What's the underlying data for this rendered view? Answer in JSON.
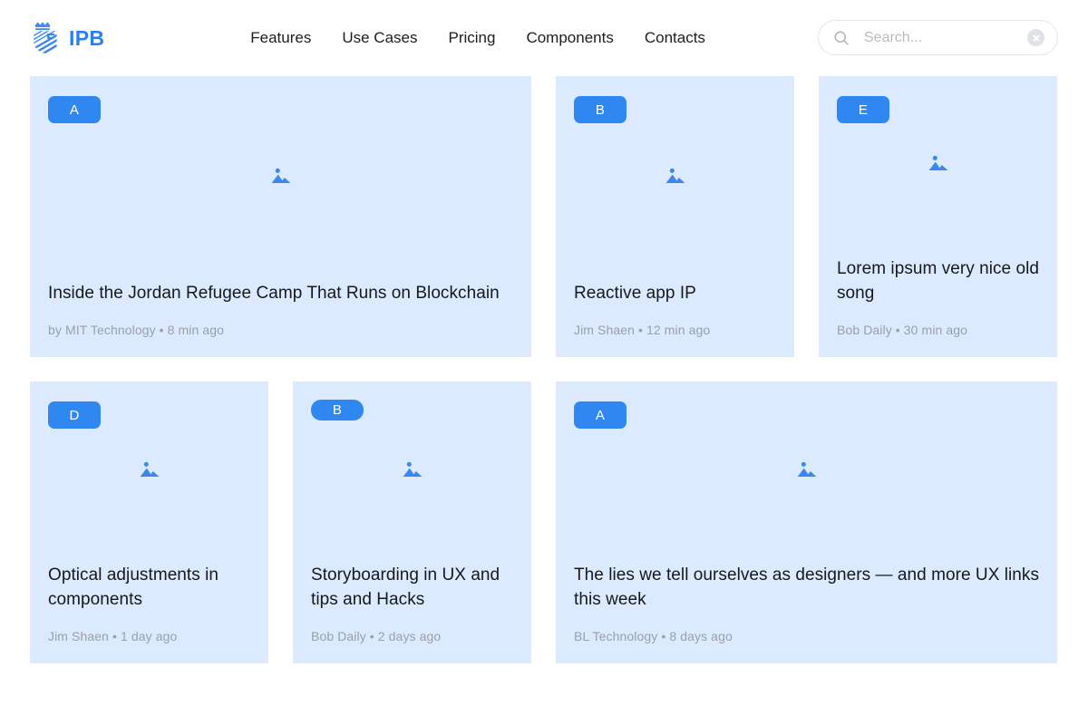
{
  "brand": {
    "name": "IPB",
    "logo_icon": "ipb-crest-icon",
    "color": "#2d7ff0"
  },
  "nav": {
    "items": [
      {
        "label": "Features"
      },
      {
        "label": "Use Cases"
      },
      {
        "label": "Pricing"
      },
      {
        "label": "Components"
      },
      {
        "label": "Contacts"
      }
    ]
  },
  "search": {
    "placeholder": "Search...",
    "value": "",
    "search_icon": "search-icon",
    "clear_icon": "clear-circle-icon"
  },
  "theme": {
    "card_bg": "#dbeafe",
    "badge_bg": "#2f88f0",
    "accent": "#2d7ff0",
    "title_color": "#16181c",
    "meta_color": "#9aa0a6",
    "page_bg": "#ffffff"
  },
  "rows": [
    {
      "cards": [
        {
          "badge": "A",
          "badge_shape": "rounded",
          "size": "wide",
          "title": "Inside the Jordan Refugee Camp That Runs on Blockchain",
          "meta": "by MIT Technology • 8 min ago",
          "author": "by MIT Technology",
          "time": "8 min ago",
          "thumb_icon": "image-placeholder-icon"
        },
        {
          "badge": "B",
          "badge_shape": "rounded",
          "size": "narrow",
          "title": "Reactive app IP",
          "meta": "Jim Shaen • 12 min ago",
          "author": "Jim Shaen",
          "time": "12 min ago",
          "thumb_icon": "image-placeholder-icon"
        },
        {
          "badge": "E",
          "badge_shape": "rounded",
          "size": "narrow",
          "title": "Lorem ipsum very nice old song",
          "meta": "Bob Daily • 30 min ago",
          "author": "Bob Daily",
          "time": "30 min ago",
          "thumb_icon": "image-placeholder-icon"
        }
      ]
    },
    {
      "cards": [
        {
          "badge": "D",
          "badge_shape": "rounded",
          "size": "narrow",
          "title": "Optical adjustments in components",
          "meta": "Jim Shaen • 1 day ago",
          "author": "Jim Shaen",
          "time": "1 day ago",
          "thumb_icon": "image-placeholder-icon"
        },
        {
          "badge": "B",
          "badge_shape": "pill",
          "size": "narrow",
          "title": "Storyboarding in UX and tips and Hacks",
          "meta": "Bob Daily • 2 days ago",
          "author": "Bob Daily",
          "time": "2 days ago",
          "thumb_icon": "image-placeholder-icon"
        },
        {
          "badge": "A",
          "badge_shape": "rounded",
          "size": "xwide",
          "title": "The lies we tell ourselves as designers — and more UX links this week",
          "meta": "BL Technology • 8 days ago",
          "author": "BL Technology",
          "time": "8 days ago",
          "thumb_icon": "image-placeholder-icon"
        }
      ]
    }
  ]
}
